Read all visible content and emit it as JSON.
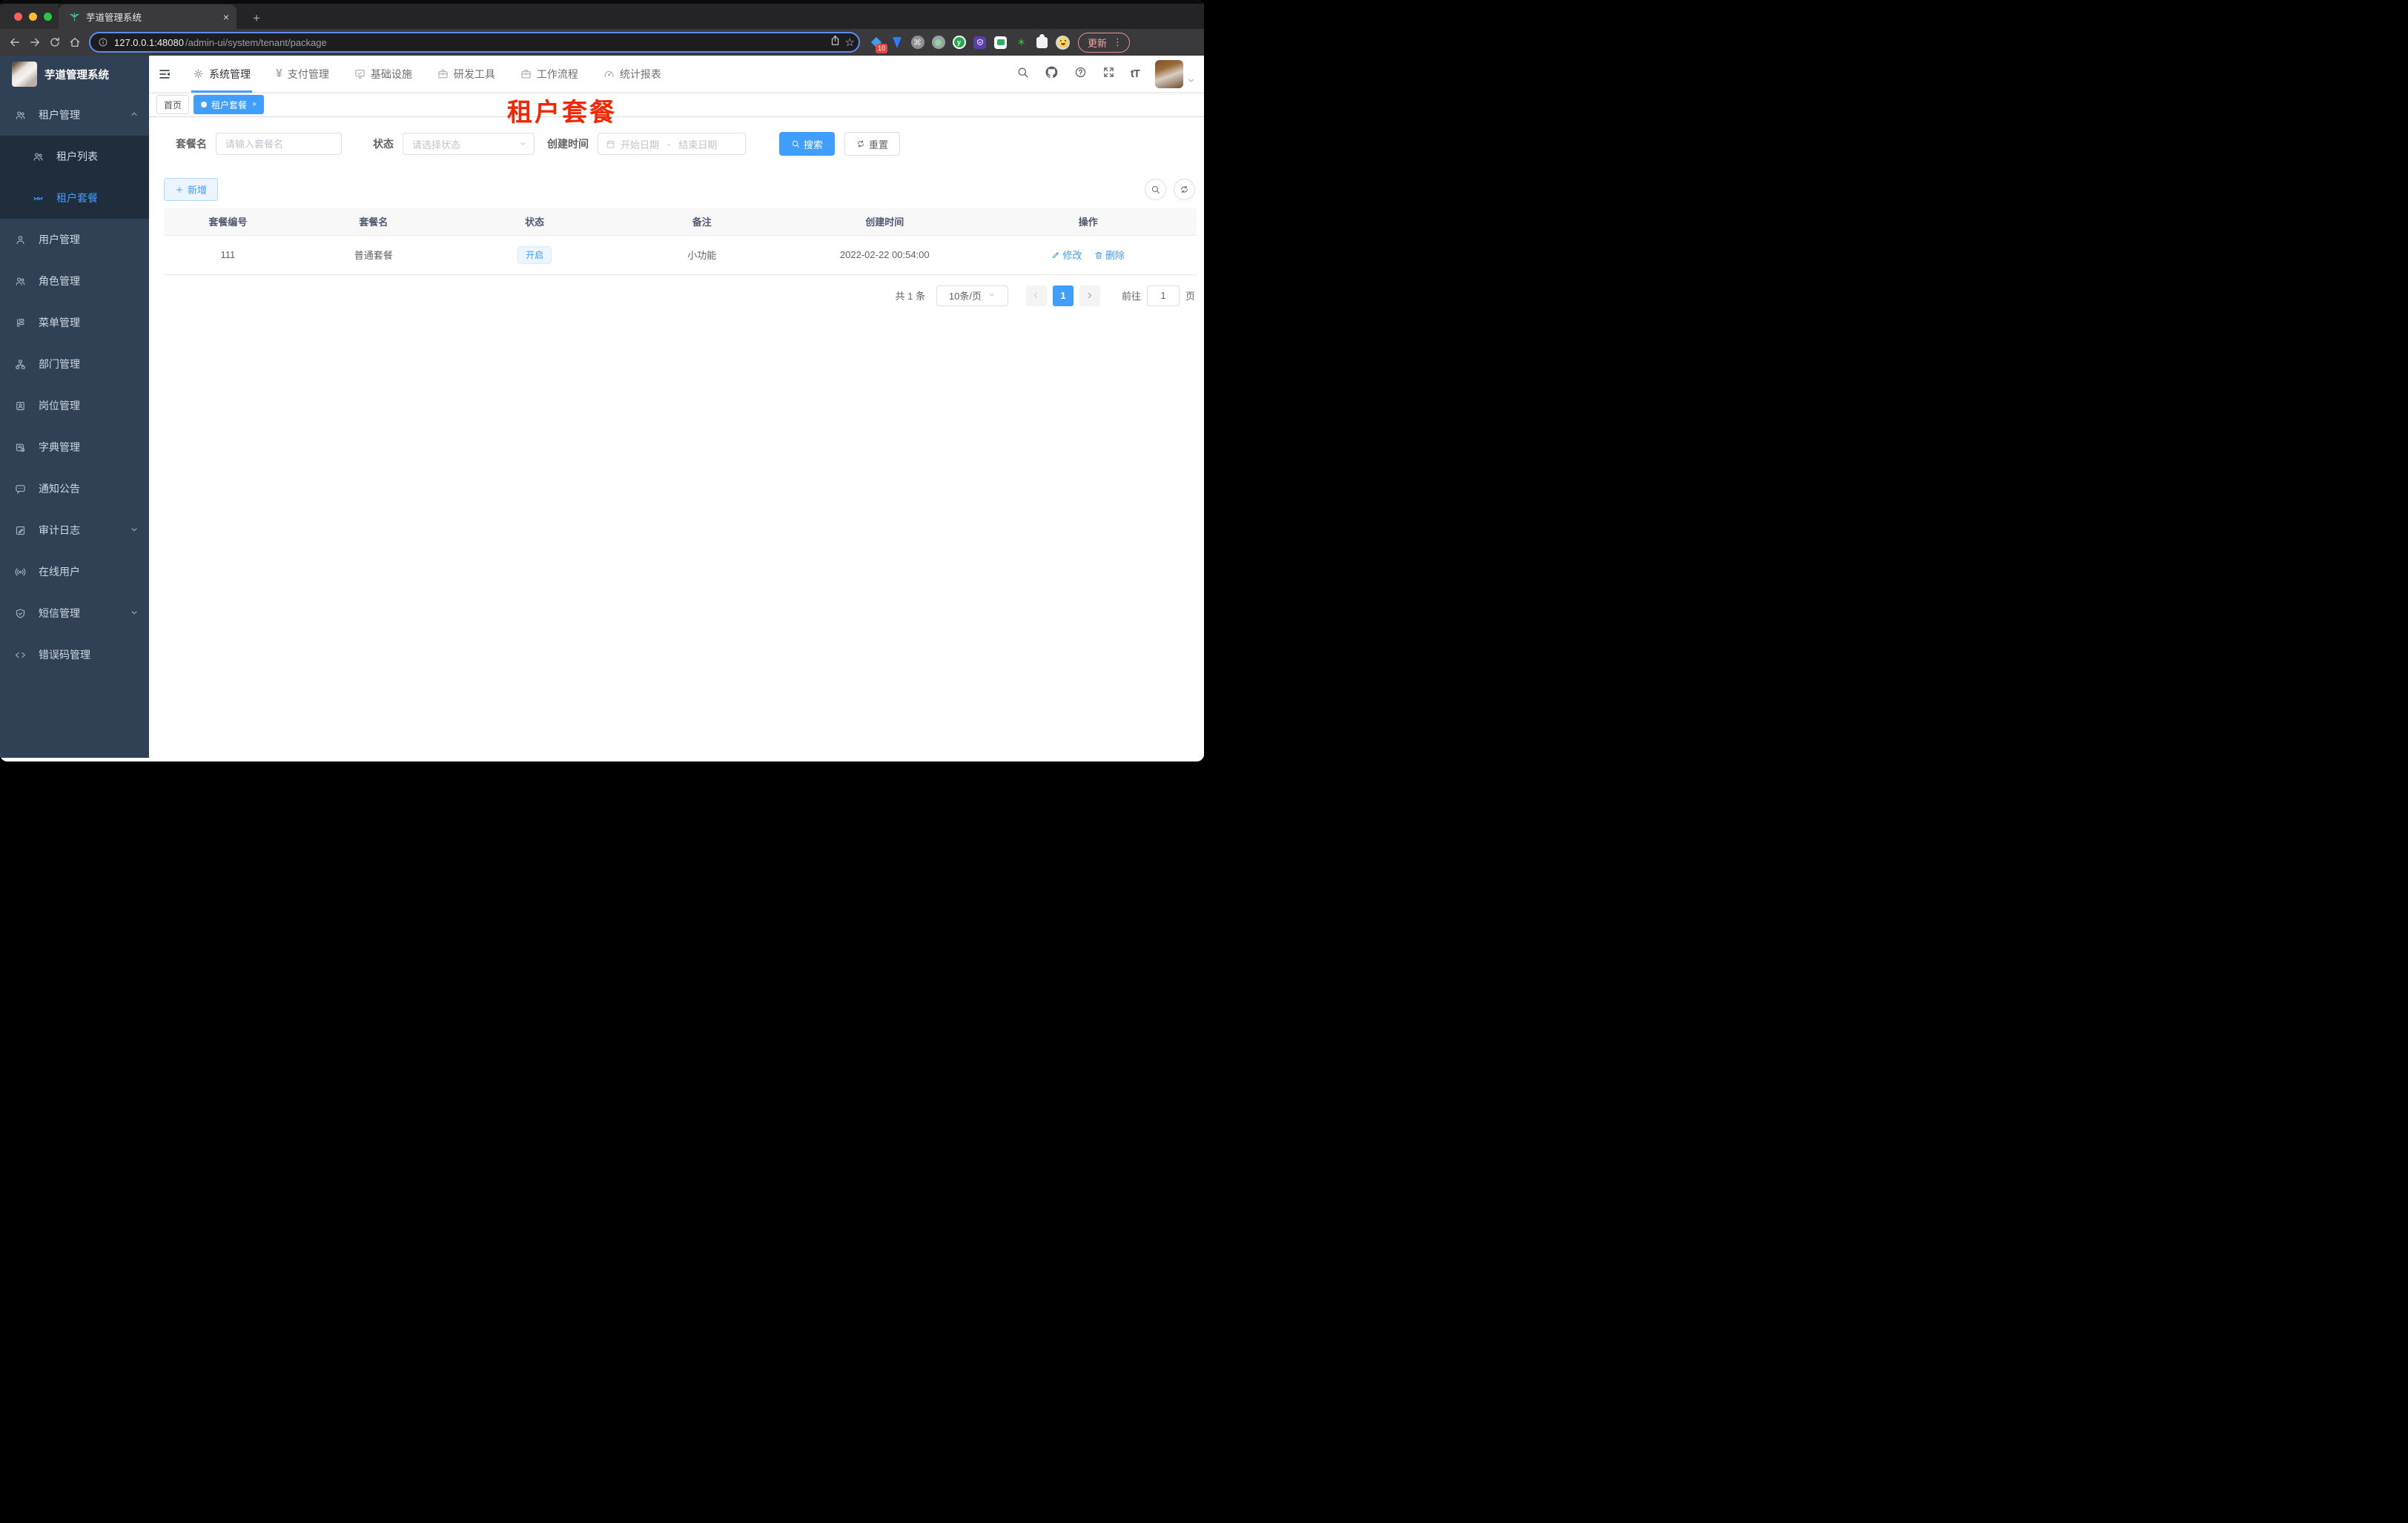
{
  "browser": {
    "tab_title": "芋道管理系统",
    "tab_close": "×",
    "new_tab": "+",
    "url_host": "127.0.0.1:48080",
    "url_path": "/admin-ui/system/tenant/package",
    "bookmark_star": "☆",
    "extensions_badge": "10",
    "command_glyph": "⌘",
    "ydev_glyph": "y",
    "star_ext_glyph": "✶",
    "update_label": "更新",
    "kebab_glyph": "⋮"
  },
  "sidebar": {
    "logo_title": "芋道管理系统",
    "items": [
      {
        "label": "租户管理"
      },
      {
        "label": "租户列表"
      },
      {
        "label": "租户套餐"
      },
      {
        "label": "用户管理"
      },
      {
        "label": "角色管理"
      },
      {
        "label": "菜单管理"
      },
      {
        "label": "部门管理"
      },
      {
        "label": "岗位管理"
      },
      {
        "label": "字典管理"
      },
      {
        "label": "通知公告"
      },
      {
        "label": "审计日志"
      },
      {
        "label": "在线用户"
      },
      {
        "label": "短信管理"
      },
      {
        "label": "错误码管理"
      }
    ]
  },
  "header": {
    "nav": [
      {
        "label": "系统管理"
      },
      {
        "label": "支付管理"
      },
      {
        "label": "基础设施"
      },
      {
        "label": "研发工具"
      },
      {
        "label": "工作流程"
      },
      {
        "label": "统计报表"
      }
    ],
    "yen_glyph": "¥",
    "fontsize_glyph": "tT"
  },
  "tags": {
    "home": "首页",
    "active": "租户套餐",
    "active_close": "×"
  },
  "annotation": "租户套餐",
  "filters": {
    "name_label": "套餐名",
    "name_placeholder": "请输入套餐名",
    "status_label": "状态",
    "status_placeholder": "请选择状态",
    "date_label": "创建时间",
    "date_start": "开始日期",
    "date_sep": "-",
    "date_end": "结束日期",
    "search_label": "搜索",
    "reset_label": "重置"
  },
  "toolbar": {
    "add_label": "新增"
  },
  "table": {
    "columns": [
      "套餐编号",
      "套餐名",
      "状态",
      "备注",
      "创建时间",
      "操作"
    ],
    "row": {
      "id": "111",
      "name": "普通套餐",
      "status": "开启",
      "remark": "小功能",
      "created": "2022-02-22 00:54:00",
      "edit": "修改",
      "delete": "删除"
    }
  },
  "pagination": {
    "total": "共 1 条",
    "size": "10条/页",
    "page": "1",
    "goto": "前往",
    "goto_value": "1",
    "unit": "页"
  },
  "colors": {
    "accent_blue": "#409eff",
    "sidebar_bg": "#304156",
    "submenu_bg": "#1f2d3d",
    "annotation_red": "#f52500",
    "tag_open_bg": "#ecf5ff"
  }
}
